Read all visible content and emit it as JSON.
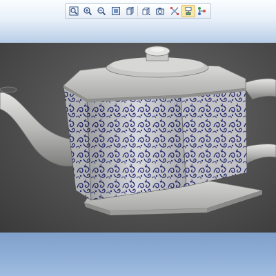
{
  "toolbar": {
    "buttons": [
      {
        "icon": "zoom-fit-icon",
        "active": false
      },
      {
        "icon": "zoom-in-icon",
        "active": false
      },
      {
        "icon": "zoom-out-icon",
        "active": false
      },
      {
        "icon": "view-area-icon",
        "active": false
      },
      {
        "icon": "shaded-cube-icon",
        "active": false
      },
      {
        "icon": "saved-views-icon",
        "active": false
      },
      {
        "icon": "camera-icon",
        "active": false
      },
      {
        "icon": "explode-icon",
        "active": false
      },
      {
        "icon": "annotation-display-icon",
        "active": true
      },
      {
        "icon": "model-tree-icon",
        "active": false
      }
    ]
  },
  "viewport": {
    "model": "teapot-with-blue-floral-pattern"
  },
  "colors": {
    "porcelain": "#cfcfcd",
    "pattern_blue": "#2a2f7a",
    "viewport_bg": "#505050",
    "app_blue": "#a8c4e2"
  }
}
